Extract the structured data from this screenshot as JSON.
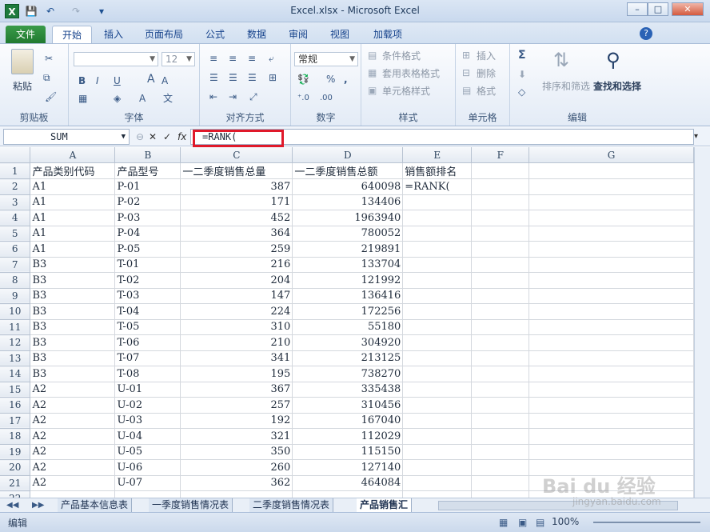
{
  "window": {
    "title": "Excel.xlsx - Microsoft Excel",
    "min": "–",
    "restore": "□",
    "close": "✕",
    "logo": "X"
  },
  "qat": {
    "save": "💾",
    "undo": "↶",
    "redo": "↷",
    "more": "▾"
  },
  "tabs": [
    {
      "label": "文件"
    },
    {
      "label": "开始"
    },
    {
      "label": "插入"
    },
    {
      "label": "页面布局"
    },
    {
      "label": "公式"
    },
    {
      "label": "数据"
    },
    {
      "label": "审阅"
    },
    {
      "label": "视图"
    },
    {
      "label": "加载项"
    }
  ],
  "ribbon": {
    "clipboard": {
      "paste": "粘贴",
      "label": "剪贴板"
    },
    "font": {
      "size": "12",
      "label": "字体",
      "bold": "B",
      "italic": "I",
      "underline": "U",
      "grow": "A",
      "shrink": "A"
    },
    "alignment": {
      "label": "对齐方式"
    },
    "number": {
      "format": "常规",
      "percent": "%",
      "comma": ",",
      "label": "数字"
    },
    "styles": {
      "cond": "条件格式",
      "table": "套用表格格式",
      "cell": "单元格样式",
      "label": "样式"
    },
    "cells": {
      "insert": "插入",
      "delete": "删除",
      "format": "格式",
      "label": "单元格"
    },
    "editing": {
      "sort": "排序和筛选",
      "find": "查找和选择",
      "label": "编辑",
      "sum": "Σ"
    }
  },
  "formula_bar": {
    "name_box": "SUM",
    "fx": "fx",
    "formula": "=RANK("
  },
  "grid": {
    "columns": [
      "",
      "A",
      "B",
      "C",
      "D",
      "E",
      "F",
      "G"
    ],
    "rows": [
      [
        "1",
        "产品类别代码",
        "产品型号",
        "一二季度销售总量",
        "一二季度销售总额",
        "销售额排名",
        "",
        ""
      ],
      [
        "2",
        "A1",
        "P-01",
        "387",
        "640098",
        "=RANK(",
        "",
        ""
      ],
      [
        "3",
        "A1",
        "P-02",
        "171",
        "134406",
        "",
        "",
        ""
      ],
      [
        "4",
        "A1",
        "P-03",
        "452",
        "1963940",
        "",
        "",
        ""
      ],
      [
        "5",
        "A1",
        "P-04",
        "364",
        "780052",
        "",
        "",
        ""
      ],
      [
        "6",
        "A1",
        "P-05",
        "259",
        "219891",
        "",
        "",
        ""
      ],
      [
        "7",
        "B3",
        "T-01",
        "216",
        "133704",
        "",
        "",
        ""
      ],
      [
        "8",
        "B3",
        "T-02",
        "204",
        "121992",
        "",
        "",
        ""
      ],
      [
        "9",
        "B3",
        "T-03",
        "147",
        "136416",
        "",
        "",
        ""
      ],
      [
        "10",
        "B3",
        "T-04",
        "224",
        "172256",
        "",
        "",
        ""
      ],
      [
        "11",
        "B3",
        "T-05",
        "310",
        "55180",
        "",
        "",
        ""
      ],
      [
        "12",
        "B3",
        "T-06",
        "210",
        "304920",
        "",
        "",
        ""
      ],
      [
        "13",
        "B3",
        "T-07",
        "341",
        "213125",
        "",
        "",
        ""
      ],
      [
        "14",
        "B3",
        "T-08",
        "195",
        "738270",
        "",
        "",
        ""
      ],
      [
        "15",
        "A2",
        "U-01",
        "367",
        "335438",
        "",
        "",
        ""
      ],
      [
        "16",
        "A2",
        "U-02",
        "257",
        "310456",
        "",
        "",
        ""
      ],
      [
        "17",
        "A2",
        "U-03",
        "192",
        "167040",
        "",
        "",
        ""
      ],
      [
        "18",
        "A2",
        "U-04",
        "321",
        "112029",
        "",
        "",
        ""
      ],
      [
        "19",
        "A2",
        "U-05",
        "350",
        "115150",
        "",
        "",
        ""
      ],
      [
        "20",
        "A2",
        "U-06",
        "260",
        "127140",
        "",
        "",
        ""
      ],
      [
        "21",
        "A2",
        "U-07",
        "362",
        "464084",
        "",
        "",
        ""
      ],
      [
        "22",
        "",
        "",
        "",
        "",
        "",
        "",
        ""
      ]
    ]
  },
  "sheets": [
    "产品基本信息表",
    "一季度销售情况表",
    "二季度销售情况表",
    "产品销售汇"
  ],
  "status": {
    "mode": "编辑",
    "zoom": "100%"
  },
  "watermark": {
    "text": "Bai du 经验",
    "sub": "jingyan.baidu.com"
  }
}
